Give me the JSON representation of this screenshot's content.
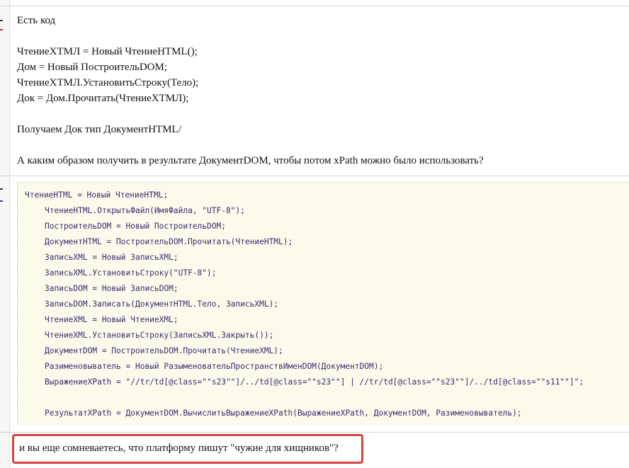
{
  "post1": {
    "lines": [
      "Есть код",
      "",
      "ЧтениеXTМЛ = Новый ЧтениеHTML();",
      "Дом = Новый ПостроительDOM;",
      "ЧтениеXTМЛ.УстановитьСтроку(Тело);",
      "Док = Дом.Прочитать(ЧтениеXTМЛ);",
      "",
      "Получаем Док тип ДокументHTML/",
      "",
      "А каким образом получить в результате ДокументDOM, чтобы потом xPath можно было использовать?"
    ]
  },
  "code": {
    "lines": [
      "ЧтениеHTML = Новый ЧтениеHTML;",
      "ЧтениеHTML.ОткрытьФайл(ИмяФайла, \"UTF-8\");",
      "ПостроительDOM = Новый ПостроительDOM;",
      "ДокументHTML = ПостроительDOM.Прочитать(ЧтениеHTML);",
      "ЗаписьXML = Новый ЗаписьXML;",
      "ЗаписьXML.УстановитьСтроку(\"UTF-8\");",
      "ЗаписьDOM = Новый ЗаписьDOM;",
      "ЗаписьDOM.Записать(ДокументHTML.Тело, ЗаписьXML);",
      "ЧтениеXML = Новый ЧтениеXML;",
      "ЧтениеXML.УстановитьСтроку(ЗаписьXML.Закрыть());",
      "ДокументDOM = ПостроительDOM.Прочитать(ЧтениеXML);",
      "Разименовыватель = Новый РазыменовательПространствИменDOM(ДокументDOM);",
      "ВыражениеXPath = \"//tr/td[@class=\"\"s23\"\"]/../td[@class=\"\"s23\"\"] | //tr/td[@class=\"\"s23\"\"]/../td[@class=\"\"s11\"\"]\";",
      "",
      "РезультатXPath = ДокументDOM.ВычислитьВыражениеXPath(ВыражениеXPath, ДокументDOM, Разименовыватель);"
    ]
  },
  "reply": {
    "text": "и вы еще сомневаетесь, что платформу пишут \"чужие для хищников\"?"
  },
  "colors": {
    "highlight": "#d9433b",
    "code_bg": "#fbfbec",
    "code_text": "#3a2d6e"
  }
}
